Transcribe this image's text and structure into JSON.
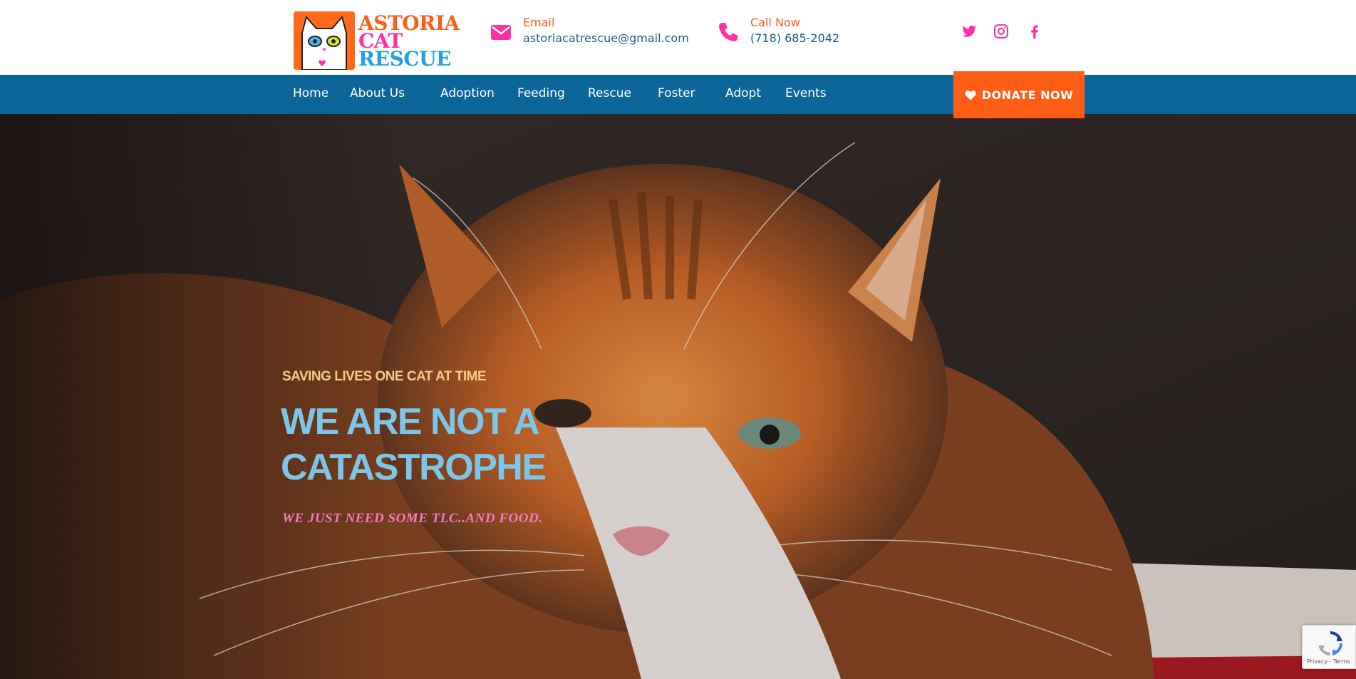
{
  "brand": {
    "logo_lines": [
      "ASTORIA",
      "CAT",
      "RESCUE"
    ],
    "colors": {
      "orange": "#ff5c15",
      "pink": "#ff2fa6",
      "blue": "#0c6699",
      "cyan": "#1fa3e0"
    }
  },
  "header": {
    "email": {
      "label": "Email",
      "value": "astoriacatrescue@gmail.com",
      "icon": "envelope-icon"
    },
    "phone": {
      "label": "Call Now",
      "value": "(718) 685-2042",
      "icon": "phone-icon"
    },
    "social": [
      {
        "name": "twitter-icon"
      },
      {
        "name": "instagram-icon"
      },
      {
        "name": "facebook-icon"
      }
    ]
  },
  "nav": {
    "items": [
      {
        "label": "Home"
      },
      {
        "label": "About Us"
      },
      {
        "label": "Adoption"
      },
      {
        "label": "Feeding"
      },
      {
        "label": "Rescue"
      },
      {
        "label": "Foster"
      },
      {
        "label": "Adopt"
      },
      {
        "label": "Events"
      }
    ],
    "donate_label": "DONATE NOW",
    "donate_icon": "heart-icon"
  },
  "hero": {
    "tagline": "SAVING LIVES ONE CAT AT TIME",
    "headline": "WE ARE NOT A CATASTROPHE",
    "subline": "WE JUST NEED SOME TLC..AND FOOD."
  },
  "recaptcha": {
    "terms": "Privacy - Terms"
  }
}
